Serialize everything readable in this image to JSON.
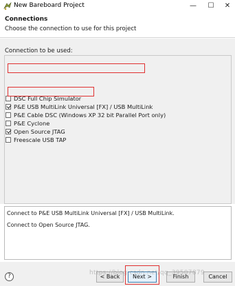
{
  "window": {
    "title": "New Bareboard Project",
    "minimize_glyph": "—",
    "maximize_glyph": "☐",
    "close_glyph": "✕",
    "icon": "wizard-app-icon"
  },
  "header": {
    "title": "Connections",
    "description": "Choose the connection to use for this project"
  },
  "connections": {
    "label": "Connection to be used:",
    "items": [
      {
        "label": "DSC Full Chip Simulator",
        "checked": false
      },
      {
        "label": "P&E USB MultiLink Universal [FX] / USB MultiLink",
        "checked": true
      },
      {
        "label": "P&E Cable DSC (Windows XP 32 bit Parallel Port only)",
        "checked": false
      },
      {
        "label": "P&E Cyclone",
        "checked": false
      },
      {
        "label": "Open Source JTAG",
        "checked": true
      },
      {
        "label": "Freescale USB TAP",
        "checked": false
      }
    ]
  },
  "details": {
    "line1": "Connect to P&E USB MultiLink Universal [FX] / USB MultiLink.",
    "line2": "Connect to Open Source JTAG."
  },
  "footer": {
    "help_glyph": "?",
    "back_label": "< Back",
    "next_label": "Next >",
    "finish_label": "Finish",
    "cancel_label": "Cancel"
  },
  "watermark": "https://blog.csdn.net/qq_39507879",
  "colors": {
    "highlight": "#e03030",
    "dialog_bg": "#f0f0f0",
    "default_button_border": "#3c7fb1"
  }
}
